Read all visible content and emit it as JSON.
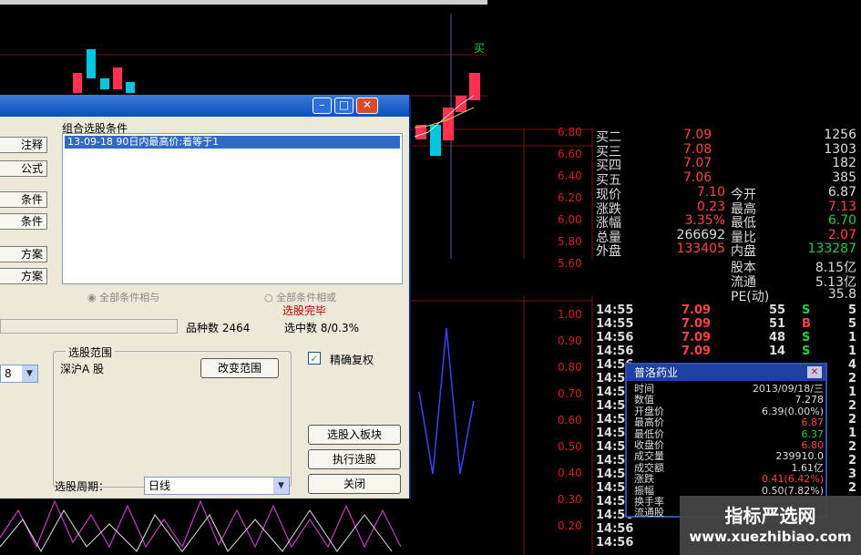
{
  "dialog": {
    "conditions_label": "组合选股条件",
    "condition_item": "13-09-18  90日内最高价:着等于1",
    "left_buttons": [
      "注释",
      "公式",
      "条件",
      "条件",
      "方案",
      "方案"
    ],
    "radio_all_match": "全部条件相与",
    "radio_any_match": "全部条件相或",
    "status": "选股完毕",
    "stock_count_label": "品种数",
    "stock_count": "2464",
    "selected_label": "选中数",
    "selected_value": "8/0.3%",
    "range_group_label": "选股范围",
    "range_value": "深沪A 股",
    "change_range_button": "改变范围",
    "exact_reweight_label": "精确复权",
    "left_dropdown_value": "8",
    "add_to_block_button": "选股入板块",
    "execute_button": "执行选股",
    "close_button": "关闭",
    "period_label": "选股周期：",
    "period_value": "日线"
  },
  "quote": {
    "bid_rows": [
      {
        "label": "买二",
        "price": "7.09",
        "volume": "1256"
      },
      {
        "label": "买三",
        "price": "7.08",
        "volume": "1303"
      },
      {
        "label": "买四",
        "price": "7.07",
        "volume": "182"
      },
      {
        "label": "买五",
        "price": "7.06",
        "volume": "385"
      }
    ],
    "stats": [
      {
        "l1": "现价",
        "v1": "7.10",
        "l2": "今开",
        "v2": "6.87"
      },
      {
        "l1": "涨跌",
        "v1": "0.23",
        "l2": "最高",
        "v2": "7.13"
      },
      {
        "l1": "涨幅",
        "v1": "3.35%",
        "l2": "最低",
        "v2": "6.70"
      },
      {
        "l1": "总量",
        "v1": "266692",
        "l2": "量比",
        "v2": "2.07"
      },
      {
        "l1": "外盘",
        "v1": "133405",
        "l2": "内盘",
        "v2": "133287"
      }
    ],
    "capital": [
      {
        "label": "股本",
        "value": "8.15亿"
      },
      {
        "label": "流通",
        "value": "5.13亿"
      },
      {
        "label": "PE(动)",
        "value": "35.8"
      }
    ],
    "ticks": [
      {
        "time": "14:55",
        "price": "7.09",
        "vol": "55",
        "dir": "S",
        "n": "5"
      },
      {
        "time": "14:55",
        "price": "7.09",
        "vol": "51",
        "dir": "B",
        "n": "5"
      },
      {
        "time": "14:56",
        "price": "7.09",
        "vol": "48",
        "dir": "S",
        "n": "1"
      },
      {
        "time": "14:56",
        "price": "7.09",
        "vol": "14",
        "dir": "S",
        "n": "1"
      }
    ],
    "more_times": [
      "14:56",
      "14:56",
      "14:56",
      "14:56",
      "14:56",
      "14:56",
      "14:56",
      "14:56",
      "14:56",
      "14:56",
      "14:56",
      "14:56",
      "14:56",
      "14:56"
    ],
    "right_edge_numbers": [
      "4",
      "2",
      "1",
      "2",
      "2",
      "1",
      "2",
      "2",
      "3",
      "2"
    ],
    "axis_top": [
      "6.80",
      "6.60",
      "6.40",
      "6.20",
      "6.00",
      "5.80",
      "5.60"
    ],
    "axis_bottom": [
      "1.00",
      "0.90",
      "0.80",
      "0.70",
      "0.60",
      "0.50",
      "0.40",
      "0.30",
      "0.20"
    ],
    "chart_label": "买"
  },
  "popup": {
    "title": "普洛药业",
    "rows": [
      {
        "label": "时间",
        "value": "2013/09/18/三"
      },
      {
        "label": "数值",
        "value": "7.278"
      },
      {
        "label": "开盘价",
        "value": "6.39(0.00%)"
      },
      {
        "label": "最高价",
        "value": "6.87"
      },
      {
        "label": "最低价",
        "value": "6.37"
      },
      {
        "label": "收盘价",
        "value": "6.80"
      },
      {
        "label": "成交量",
        "value": "239910.0"
      },
      {
        "label": "成交额",
        "value": "1.61亿"
      },
      {
        "label": "涨跌",
        "value": "0.41(6.42%)"
      },
      {
        "label": "振幅",
        "value": "0.50(7.82%)"
      },
      {
        "label": "换手率",
        "value": ""
      },
      {
        "label": "流通股",
        "value": ""
      }
    ]
  },
  "watermark": {
    "line1": "指标严选网",
    "line2": "www.xuezhibiao.com"
  },
  "colors": {
    "up": "#ff4444",
    "down": "#00c0c0",
    "green": "#22cc44",
    "chart_bg": "#000000"
  }
}
